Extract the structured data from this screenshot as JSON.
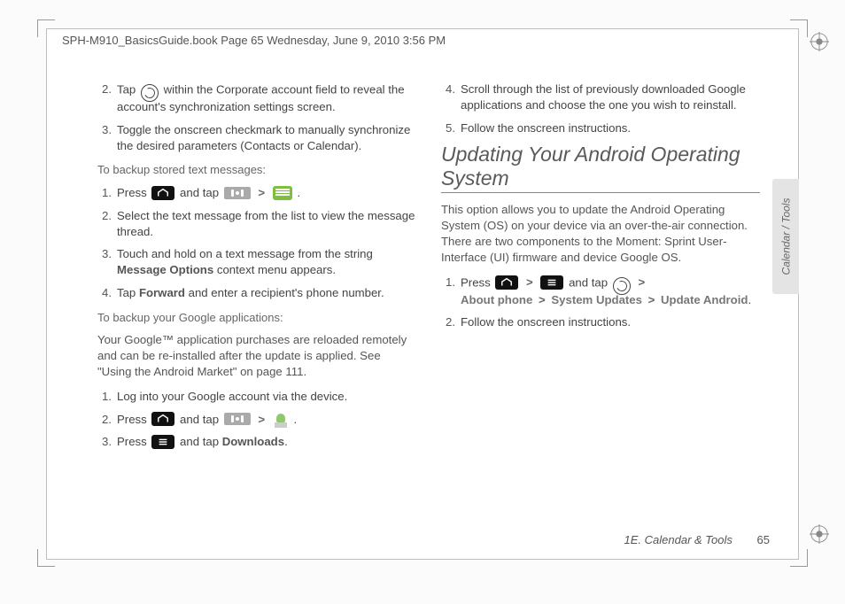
{
  "header": "SPH-M910_BasicsGuide.book  Page 65  Wednesday, June 9, 2010  3:56 PM",
  "side_tab": "Calendar / Tools",
  "footer_section": "1E. Calendar & Tools",
  "footer_page": "65",
  "col1": {
    "steps_a": [
      {
        "n": "2.",
        "pre": "Tap ",
        "post": " within the Corporate account field to reveal the account's synchronization settings screen."
      },
      {
        "n": "3.",
        "text": "Toggle the onscreen checkmark to manually synchronize the desired parameters (Contacts or Calendar)."
      }
    ],
    "sub_b": "To backup stored text messages:",
    "steps_b": [
      {
        "n": "1.",
        "pre": "Press ",
        "mid": " and tap ",
        "post": " ."
      },
      {
        "n": "2.",
        "text": "Select the text message from the list to view the message thread."
      },
      {
        "n": "3.",
        "pre": "Touch and hold on a text message from the string ",
        "bold": "Message Options",
        "post": " context menu appears."
      },
      {
        "n": "4.",
        "pre": "Tap ",
        "bold": "Forward",
        "post": " and enter a recipient's phone number."
      }
    ],
    "sub_c": "To backup your Google applications:",
    "para_c": "Your Google™ application purchases are reloaded remotely and can be re-installed after the update is applied. See \"Using the Android Market\" on page 111.",
    "steps_c": [
      {
        "n": "1.",
        "text": "Log into your Google account via the device."
      },
      {
        "n": "2.",
        "pre": "Press ",
        "mid": " and tap ",
        "post": " ."
      },
      {
        "n": "3.",
        "pre": "Press ",
        "mid": " and tap ",
        "bold": "Downloads",
        "post": "."
      }
    ]
  },
  "col2": {
    "steps_d": [
      {
        "n": "4.",
        "text": "Scroll through the list of previously downloaded Google applications and choose the one you wish to reinstall."
      },
      {
        "n": "5.",
        "text": "Follow the onscreen instructions."
      }
    ],
    "heading": "Updating Your Android Operating System",
    "para": "This option allows you to update the Android Operating System (OS) on your device via an over-the-air connection. There are two components to the Moment: Sprint User-Interface (UI) firmware and device Google OS.",
    "steps_e": [
      {
        "n": "1.",
        "pre": "Press ",
        "mid": " and tap ",
        "path": [
          "About phone",
          "System Updates",
          "Update Android"
        ],
        "post": "."
      },
      {
        "n": "2.",
        "text": "Follow the onscreen instructions."
      }
    ]
  }
}
